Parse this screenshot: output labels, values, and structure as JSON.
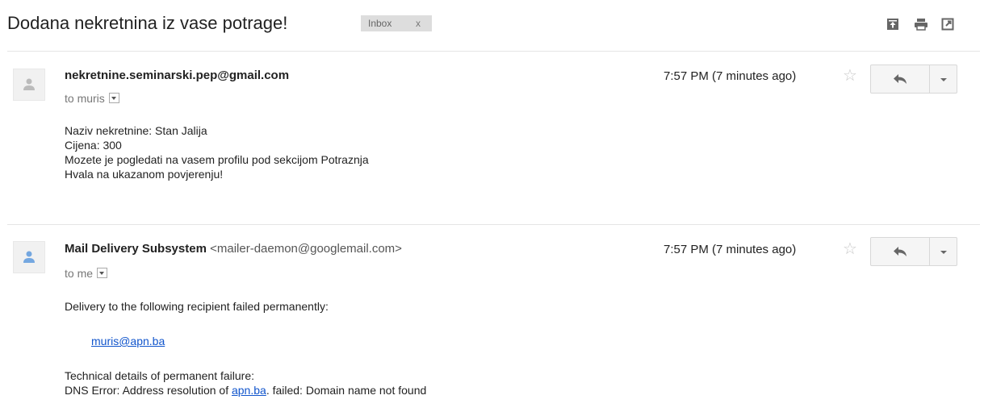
{
  "subject": "Dodana nekretnina iz vase potrage!",
  "label": {
    "name": "Inbox",
    "close": "x"
  },
  "toolbar_icons": [
    "expand-all-icon",
    "print-icon",
    "new-window-icon"
  ],
  "messages": [
    {
      "sender_name": "nekretnine.seminarski.pep@gmail.com",
      "sender_email": "",
      "to": "to muris",
      "time": "7:57 PM (7 minutes ago)",
      "star": "☆",
      "body_lines": [
        "Naziv nekretnine: Stan Jalija",
        "Cijena: 300",
        "Mozete je pogledati na vasem profilu pod sekcijom Potraznja",
        "Hvala na ukazanom povjerenju!"
      ]
    },
    {
      "sender_name": "Mail Delivery Subsystem",
      "sender_email": "<mailer-daemon@googlemail.com>",
      "to": "to me",
      "time": "7:57 PM (7 minutes ago)",
      "star": "☆",
      "line1": "Delivery to the following recipient failed permanently:",
      "recipient_link": "muris@apn.ba",
      "line2": "Technical details of permanent failure:",
      "dns_prefix": "DNS Error: Address resolution of ",
      "dns_link": "apn.ba",
      "dns_suffix": ". failed: Domain name not found"
    }
  ],
  "colors": {
    "link": "#1155cc",
    "avatar_grey": "#bbbbbb",
    "avatar_blue": "#74a7e0"
  }
}
